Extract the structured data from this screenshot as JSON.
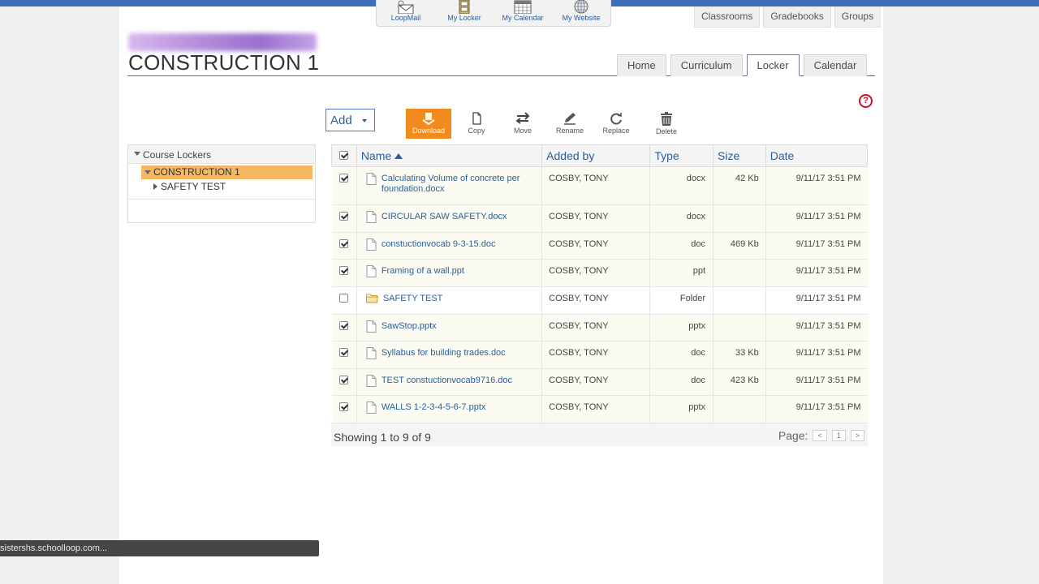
{
  "apps": [
    {
      "label": "LoopMail",
      "icon": "mail-icon"
    },
    {
      "label": "My Locker",
      "icon": "locker-icon"
    },
    {
      "label": "My Calendar",
      "icon": "calendar-icon"
    },
    {
      "label": "My Website",
      "icon": "globe-icon"
    }
  ],
  "toplinks": [
    "Classrooms",
    "Gradebooks",
    "Groups"
  ],
  "course": {
    "title": "CONSTRUCTION 1"
  },
  "tabs": [
    "Home",
    "Curriculum",
    "Locker",
    "Calendar"
  ],
  "active_tab": "Locker",
  "help": {
    "label": "?"
  },
  "toolbar": {
    "add_label": "Add",
    "download_label": "Download",
    "copy_label": "Copy",
    "move_label": "Move",
    "rename_label": "Rename",
    "replace_label": "Replace",
    "delete_label": "Delete"
  },
  "tree": {
    "root_label": "Course Lockers",
    "selected_label": "CONSTRUCTION 1",
    "child_label": "SAFETY TEST"
  },
  "table": {
    "headers": {
      "name": "Name",
      "added": "Added by",
      "type": "Type",
      "size": "Size",
      "date": "Date"
    },
    "rows": [
      {
        "checked": true,
        "icon": "file-icon",
        "name": "Calculating Volume of concrete per foundation.docx",
        "added": "COSBY, TONY",
        "type": "docx",
        "size": "42 Kb",
        "date": "9/11/17 3:51 PM"
      },
      {
        "checked": true,
        "icon": "file-icon",
        "name": "CIRCULAR SAW SAFETY.docx",
        "added": "COSBY, TONY",
        "type": "docx",
        "size": "",
        "date": "9/11/17 3:51 PM"
      },
      {
        "checked": true,
        "icon": "file-icon",
        "name": "constuctionvocab 9-3-15.doc",
        "added": "COSBY, TONY",
        "type": "doc",
        "size": "469 Kb",
        "date": "9/11/17 3:51 PM"
      },
      {
        "checked": true,
        "icon": "file-icon",
        "name": "Framing of a wall.ppt",
        "added": "COSBY, TONY",
        "type": "ppt",
        "size": "",
        "date": "9/11/17 3:51 PM"
      },
      {
        "checked": false,
        "icon": "folder-icon",
        "name": "SAFETY TEST",
        "added": "COSBY, TONY",
        "type": "Folder",
        "size": "",
        "date": "9/11/17 3:51 PM"
      },
      {
        "checked": true,
        "icon": "file-icon",
        "name": "SawStop.pptx",
        "added": "COSBY, TONY",
        "type": "pptx",
        "size": "",
        "date": "9/11/17 3:51 PM"
      },
      {
        "checked": true,
        "icon": "file-icon",
        "name": "Syllabus for building trades.doc",
        "added": "COSBY, TONY",
        "type": "doc",
        "size": "33 Kb",
        "date": "9/11/17 3:51 PM"
      },
      {
        "checked": true,
        "icon": "file-icon",
        "name": "TEST constuctionvocab9716.doc",
        "added": "COSBY, TONY",
        "type": "doc",
        "size": "423 Kb",
        "date": "9/11/17 3:51 PM"
      },
      {
        "checked": true,
        "icon": "file-icon",
        "name": "WALLS 1-2-3-4-5-6-7.pptx",
        "added": "COSBY, TONY",
        "type": "pptx",
        "size": "",
        "date": "9/11/17 3:51 PM"
      }
    ]
  },
  "footer": {
    "showing": "Showing 1 to 9 of 9",
    "page_label": "Page:",
    "prev": "<",
    "page": "1",
    "next": ">"
  },
  "statusbar": {
    "text": "sistershs.schoolloop.com..."
  },
  "colors": {
    "accent": "#2b5e9a",
    "download": "#f28b1e",
    "tree_selected": "#f4b862",
    "topbar": "#3f6fb6",
    "tab_border": "#8a6aa8"
  }
}
